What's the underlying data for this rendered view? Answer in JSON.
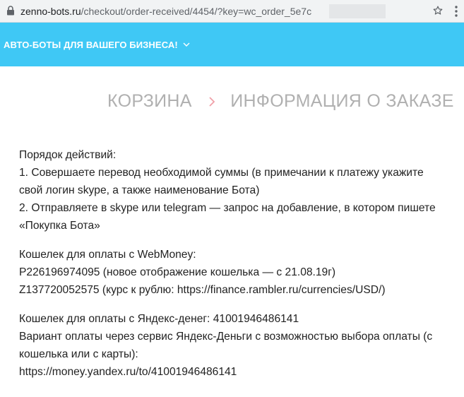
{
  "browser": {
    "url_domain": "zenno-bots.ru",
    "url_path": "/checkout/order-received/4454/?key=wc_order_5e7c"
  },
  "header": {
    "brand": "АВТО-БОТЫ ДЛЯ ВАШЕГО БИЗНЕСА!",
    "accent_color": "#3fc8f5"
  },
  "breadcrumb": {
    "items": [
      "КОРЗИНА",
      "ИНФОРМАЦИЯ О ЗАКАЗЕ"
    ]
  },
  "content": {
    "steps_title": "Порядок действий:",
    "step1": "1. Совершаете перевод необходимой суммы (в примечании к платежу укажите свой логин skype, а также наименование Бота)",
    "step2": "2. Отправляете в skype или telegram — запрос на добавление, в котором пишете «Покупка Бота»",
    "webmoney_title": "Кошелек для оплаты с WebMoney:",
    "webmoney_p": "P226196974095 (новое отображение кошелька — с 21.08.19г)",
    "webmoney_z_prefix": "Z137720052575 (курс к рублю: ",
    "webmoney_z_link": "https://finance.rambler.ru/currencies/USD/",
    "webmoney_z_suffix": ")",
    "yandex_wallet": "Кошелек для оплаты с Яндекс-денег: 41001946486141",
    "yandex_variant": "Вариант оплаты через сервис Яндекс-Деньги с возможностью выбора оплаты (с кошелька или с карты):",
    "yandex_link": "https://money.yandex.ru/to/41001946486141"
  }
}
